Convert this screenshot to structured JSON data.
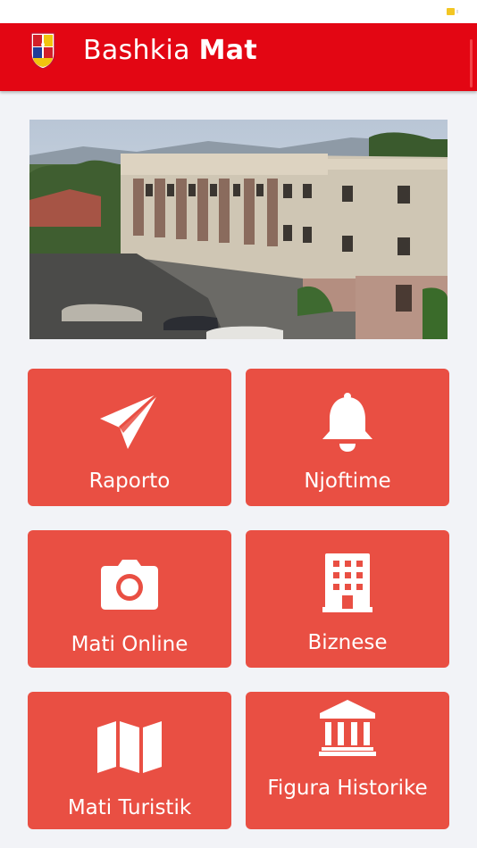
{
  "app": {
    "title_prefix": "Bashkia",
    "title_bold": "Mat"
  },
  "hero": {
    "image": "municipality-building-photo"
  },
  "tiles": [
    {
      "label": "Raporto",
      "icon": "paper-plane-icon"
    },
    {
      "label": "Njoftime",
      "icon": "bell-icon"
    },
    {
      "label": "Mati Online",
      "icon": "camera-icon"
    },
    {
      "label": "Biznese",
      "icon": "building-icon"
    },
    {
      "label": "Mati Turistik",
      "icon": "map-icon"
    },
    {
      "label": "Figura Historike",
      "icon": "museum-icon"
    }
  ],
  "colors": {
    "appbar": "#e30613",
    "tile": "#e94f43",
    "background": "#f2f3f7"
  }
}
